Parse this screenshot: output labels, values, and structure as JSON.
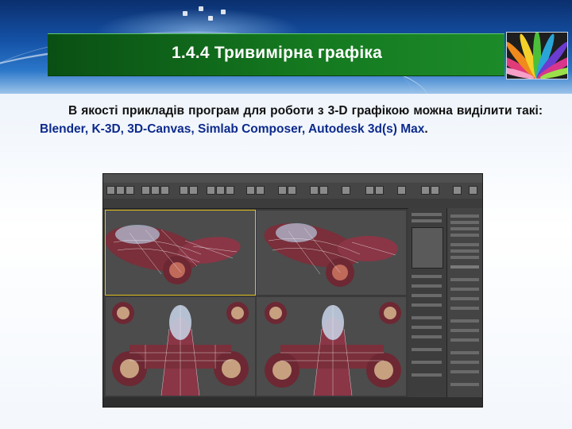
{
  "slide": {
    "title": "1.4.4 Тривимірна графіка",
    "paragraph_intro": "В якості прикладів програм для роботи з 3-D графікою можна виділити такі: ",
    "paragraph_programs": "Blender, K-3D, 3D-Canvas, Simlab Composer, Autodesk 3d(s) Max",
    "paragraph_end": ".",
    "colors": {
      "header_blue": "#1553a8",
      "title_bar_green": "#14781f",
      "title_text": "#ffffff",
      "body_text": "#111111",
      "highlight_text": "#0d2a8c"
    }
  },
  "screenshot": {
    "description_icon": "3d-modeling-software-screenshot",
    "model_color": "#7a2f3a",
    "viewport_bg": "#4a4a4a",
    "ui_bg": "#3a3a3a"
  },
  "decor": {
    "logo_icon": "colorful-feathers-icon"
  }
}
